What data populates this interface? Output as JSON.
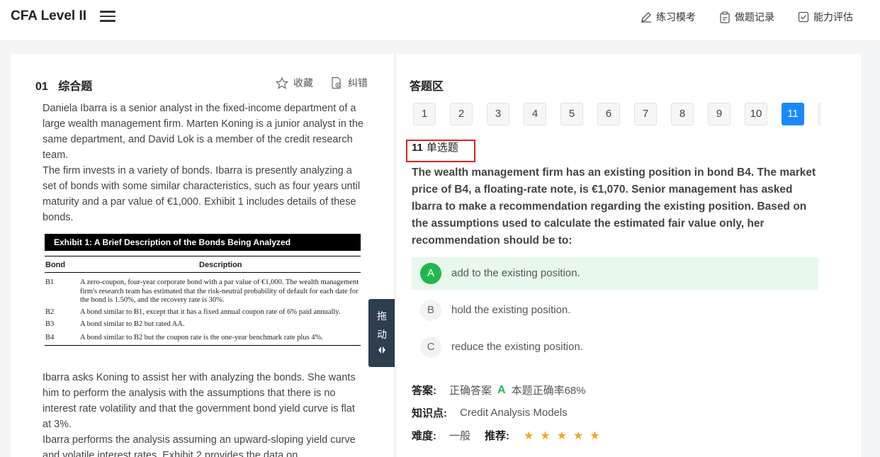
{
  "header": {
    "title": "CFA Level II",
    "nav": [
      {
        "label": "练习模考",
        "icon": "pencil-icon"
      },
      {
        "label": "做题记录",
        "icon": "clipboard-icon"
      },
      {
        "label": "能力评估",
        "icon": "check-square-icon"
      }
    ]
  },
  "question": {
    "number": "01",
    "type": "综合题",
    "favorite_label": "收藏",
    "report_label": "纠错",
    "passage_top": [
      "Daniela Ibarra is a senior analyst in the fixed-income department of a large wealth management firm. Marten Koning is a junior analyst in the same department, and David Lok is a member of the credit research team.",
      "The firm invests in a variety of bonds. Ibarra is presently analyzing a set of bonds with some similar characteristics, such as four years until maturity and a par value of €1,000. Exhibit 1 includes details of these bonds."
    ],
    "exhibit": {
      "title": "Exhibit 1: A Brief Description of the Bonds Being Analyzed",
      "col_bond": "Bond",
      "col_desc": "Description",
      "rows": [
        {
          "bond": "B1",
          "desc": "A zero-coupon, four-year corporate bond with a par value of €1,000. The wealth management firm's research team has estimated that the risk-neutral probability of default for each date for the bond is 1.50%, and the recovery rate is 30%."
        },
        {
          "bond": "B2",
          "desc": "A bond similar to B1, except that it has a fixed annual coupon rate of 6% paid annually."
        },
        {
          "bond": "B3",
          "desc": "A bond similar to B2 but rated AA."
        },
        {
          "bond": "B4",
          "desc": "A bond similar to B2 but the coupon rate is the one-year benchmark rate plus 4%."
        }
      ]
    },
    "passage_bottom": [
      "Ibarra asks Koning to assist her with analyzing the bonds. She wants him to perform the analysis with the assumptions that there is no interest rate volatility and that the government bond yield curve is flat at 3%.",
      "Ibarra performs the analysis assuming an upward-sloping yield curve and volatile interest rates. Exhibit 2 provides the data on"
    ]
  },
  "drag_handle": {
    "line1": "拖",
    "line2": "动"
  },
  "answer_area": {
    "title": "答题区",
    "pages": [
      "1",
      "2",
      "3",
      "4",
      "5",
      "6",
      "7",
      "8",
      "9",
      "10",
      "11"
    ],
    "active_page": "11",
    "current_number": "11",
    "current_type": "单选题",
    "stem": "The wealth management firm has an existing position in bond B4. The market price of B4, a floating-rate note, is €1,070. Senior management has asked Ibarra to make a recommendation regarding the existing position. Based on the assumptions used to calculate the estimated fair value only, her recommendation should be to:",
    "options": [
      {
        "letter": "A",
        "text": "add to the existing position.",
        "correct": true
      },
      {
        "letter": "B",
        "text": "hold the existing position.",
        "correct": false
      },
      {
        "letter": "C",
        "text": "reduce the existing position.",
        "correct": false
      }
    ],
    "answer_label": "答案:",
    "correct_answer_label": "正确答案",
    "correct_answer": "A",
    "accuracy": "本题正确率68%",
    "knowledge_label": "知识点:",
    "knowledge": "Credit Analysis Models",
    "difficulty_label": "难度:",
    "difficulty": "一般",
    "recommend_label": "推荐:",
    "recommend_stars": 5,
    "colors": {
      "accent": "#1989fa",
      "correct": "#20b84a",
      "star": "#f5a623",
      "highlight": "#e02020"
    }
  }
}
